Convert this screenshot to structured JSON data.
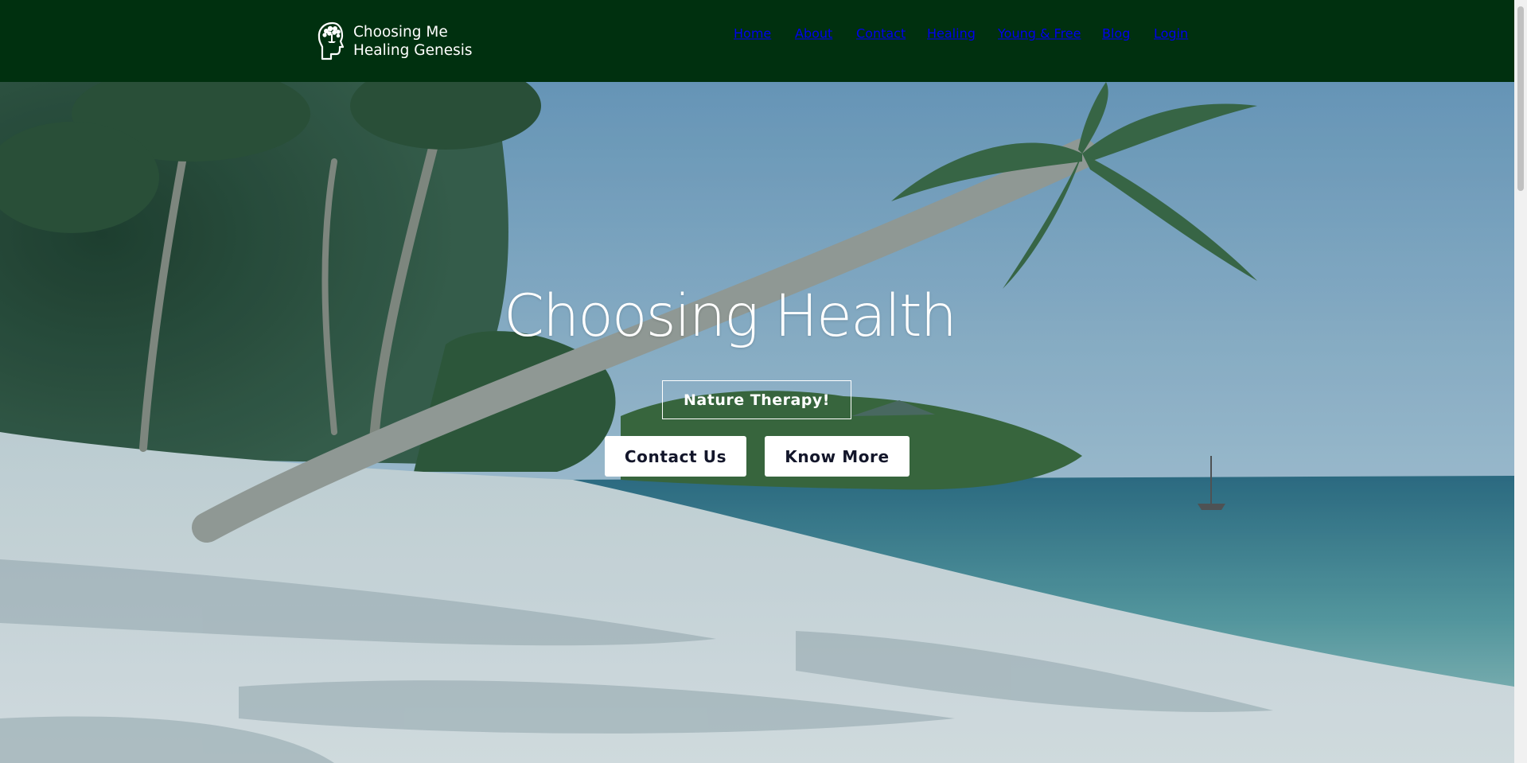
{
  "header": {
    "brand": {
      "line1": "Choosing Me",
      "line2": "Healing Genesis",
      "logo_icon": "head-with-tree-icon"
    },
    "nav": [
      {
        "label": "Home",
        "name": "nav-home"
      },
      {
        "label": "About",
        "name": "nav-about"
      },
      {
        "label": "Contact",
        "name": "nav-contact"
      },
      {
        "label": "Healing",
        "name": "nav-healing"
      },
      {
        "label": "Young & Free",
        "name": "nav-young-free"
      },
      {
        "label": "Blog",
        "name": "nav-blog"
      },
      {
        "label": "Login",
        "name": "nav-login"
      }
    ]
  },
  "hero": {
    "title": "Choosing Health",
    "tag": "Nature Therapy!",
    "contact_button": "Contact Us",
    "more_button": "Know More",
    "background": "beach-with-palm-trees"
  },
  "colors": {
    "header_bg": "#00300f",
    "button_bg": "#ffffff",
    "button_text": "#13162a"
  }
}
